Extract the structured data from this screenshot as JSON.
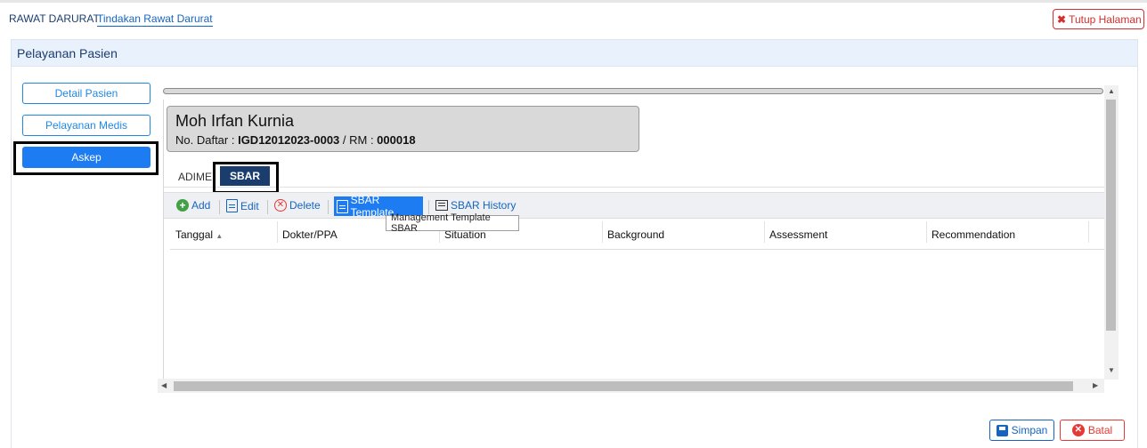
{
  "breadcrumb": {
    "root": "RAWAT DARURAT",
    "current": "Tindakan Rawat Darurat"
  },
  "header": {
    "close_label": "Tutup Halaman"
  },
  "panel": {
    "title": "Pelayanan Pasien"
  },
  "sidebar": {
    "items": [
      {
        "label": "Detail Pasien"
      },
      {
        "label": "Pelayanan Medis"
      },
      {
        "label": "Askep",
        "active": true
      }
    ]
  },
  "patient": {
    "name": "Moh Irfan Kurnia",
    "reg_prefix": "No. Daftar : ",
    "reg_no": "IGD12012023-0003",
    "rm_prefix": " / RM : ",
    "rm_no": "000018"
  },
  "tabs": [
    {
      "label": "ADIME"
    },
    {
      "label": "SBAR",
      "active": true
    }
  ],
  "toolbar": {
    "add": "Add",
    "edit": "Edit",
    "delete": "Delete",
    "template": "SBAR Template",
    "history": "SBAR History",
    "tooltip": "Management Template SBAR"
  },
  "grid": {
    "columns": [
      "Tanggal",
      "Dokter/PPA",
      "Situation",
      "Background",
      "Assessment",
      "Recommendation"
    ],
    "sort_indicator": "▲"
  },
  "footer": {
    "save": "Simpan",
    "cancel": "Batal"
  },
  "colors": {
    "accent": "#1e7cf2",
    "navy": "#1a3d6e",
    "danger": "#e53935"
  }
}
